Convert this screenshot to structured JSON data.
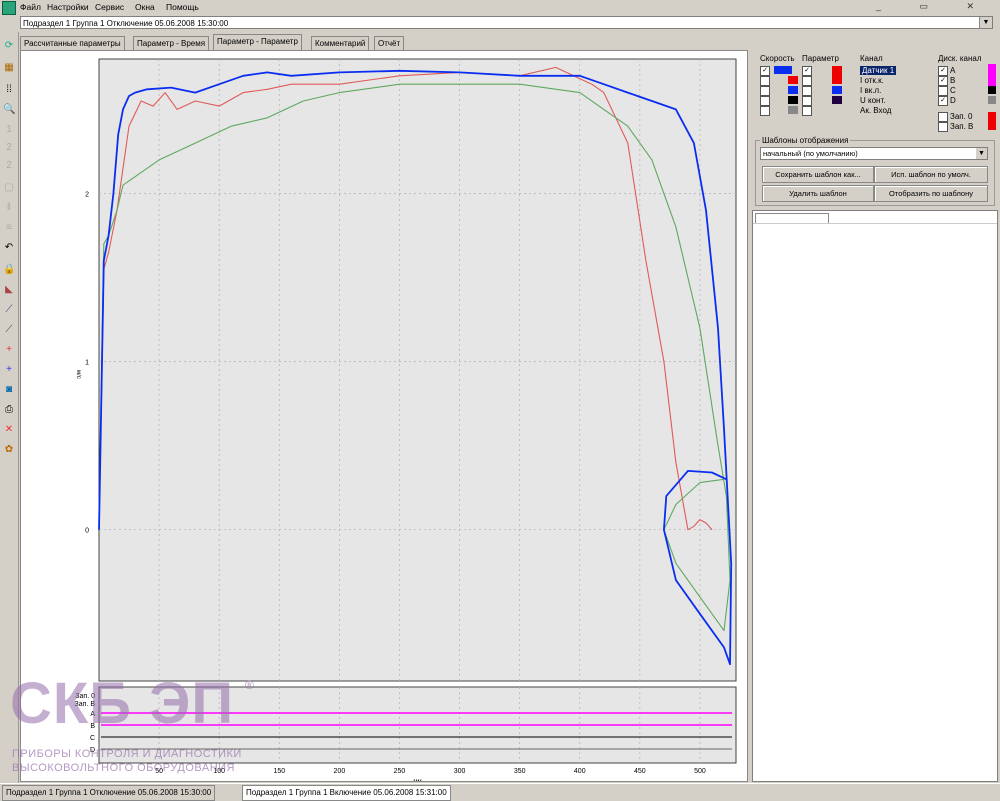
{
  "menu": {
    "items": [
      "Файл",
      "Настройки",
      "Сервис",
      "Окна",
      "Помощь"
    ]
  },
  "window": {
    "title": "Подраздел 1 Группа 1 Отключение 05.06.2008 15:30:00"
  },
  "tabs": [
    "Рассчитанные параметры",
    "Параметр - Время",
    "Параметр - Параметр",
    "Комментарий",
    "Отчёт"
  ],
  "active_tab": 2,
  "right": {
    "headers": {
      "speed": "Скорость",
      "param": "Параметр",
      "channel": "Канал",
      "discrete": "Диск. канал"
    },
    "channels": [
      "Датчик 1",
      "I отк.к.",
      "I вк.л.",
      "U конт.",
      "Ак. Вход"
    ],
    "discrete": [
      "A",
      "B",
      "C",
      "D"
    ],
    "extra": [
      "Зап. 0",
      "Зап. B"
    ],
    "templates_label": "Шаблоны отображения",
    "template_value": "начальный (по умолчанию)",
    "buttons": {
      "save": "Сохранить шаблон как...",
      "use_default": "Исп. шаблон по умолч.",
      "delete": "Удалить шаблон",
      "show_by": "Отобразить по шаблону"
    }
  },
  "colors": {
    "red": "#e05a5a",
    "green": "#5fa85f",
    "blue": "#0a2ef0",
    "magenta": "#ff00ff",
    "grid": "#b0b0b0"
  },
  "chart_data": {
    "type": "line",
    "xlabel": "мм",
    "ylabel": "м/с",
    "xlim": [
      0,
      530
    ],
    "ylim": [
      -0.9,
      2.8
    ],
    "x_ticks": [
      50,
      100,
      150,
      200,
      250,
      300,
      350,
      400,
      450,
      500
    ],
    "y_ticks": [
      0,
      1,
      2
    ],
    "x_tick_labels": [
      "50",
      "100",
      "150",
      "200",
      "250",
      "300",
      "350",
      "400",
      "450",
      "500"
    ],
    "y_tick_labels": [
      "0",
      "1",
      "2"
    ],
    "series": [
      {
        "color": "#e05a5a",
        "x": [
          0,
          4,
          8,
          15,
          25,
          35,
          45,
          55,
          65,
          80,
          100,
          120,
          140,
          160,
          200,
          250,
          300,
          350,
          380,
          410,
          420,
          440,
          455,
          470,
          480,
          490,
          495,
          500,
          505,
          510
        ],
        "y": [
          0,
          1.55,
          1.65,
          1.9,
          2.4,
          2.55,
          2.52,
          2.6,
          2.5,
          2.55,
          2.52,
          2.6,
          2.62,
          2.65,
          2.65,
          2.7,
          2.72,
          2.7,
          2.75,
          2.65,
          2.6,
          2.3,
          1.6,
          1.0,
          0.4,
          0.0,
          0.02,
          0.06,
          0.04,
          0.0
        ]
      },
      {
        "color": "#5fa85f",
        "x": [
          0,
          4,
          8,
          15,
          20,
          30,
          50,
          80,
          110,
          140,
          170,
          200,
          250,
          300,
          350,
          400,
          420,
          440,
          460,
          480,
          500,
          515,
          522,
          525,
          520,
          500,
          480,
          470,
          480,
          500,
          520
        ],
        "y": [
          0,
          1.7,
          1.75,
          1.9,
          2.05,
          2.1,
          2.2,
          2.3,
          2.4,
          2.45,
          2.55,
          2.6,
          2.65,
          2.65,
          2.65,
          2.6,
          2.5,
          2.4,
          2.2,
          1.8,
          1.2,
          0.5,
          0.2,
          -0.3,
          -0.6,
          -0.4,
          -0.2,
          0.0,
          0.15,
          0.28,
          0.3
        ]
      },
      {
        "color": "#0a2ef0",
        "x": [
          0,
          4,
          8,
          12,
          16,
          20,
          25,
          30,
          40,
          60,
          80,
          100,
          120,
          140,
          160,
          200,
          250,
          300,
          350,
          380,
          400,
          420,
          440,
          460,
          480,
          495,
          505,
          515,
          520,
          523,
          526,
          525,
          520,
          500,
          480,
          470,
          472,
          490,
          510,
          522
        ],
        "y": [
          0,
          1.6,
          1.75,
          2.0,
          2.35,
          2.5,
          2.58,
          2.6,
          2.62,
          2.63,
          2.6,
          2.65,
          2.7,
          2.72,
          2.7,
          2.72,
          2.73,
          2.72,
          2.7,
          2.7,
          2.7,
          2.65,
          2.6,
          2.55,
          2.5,
          2.3,
          1.9,
          1.2,
          0.6,
          0.2,
          -0.2,
          -0.8,
          -0.7,
          -0.5,
          -0.3,
          0.0,
          0.2,
          0.35,
          0.34,
          0.3
        ]
      }
    ]
  },
  "mini": {
    "labels": [
      "Зап. 0",
      "Зап. B",
      "A",
      "B",
      "C",
      "D"
    ]
  },
  "logo": {
    "main": "СКБ ЭП",
    "reg": "®",
    "line1": "ПРИБОРЫ КОНТРОЛЯ И ДИАГНОСТИКИ",
    "line2": "ВЫСОКОВОЛЬТНОГО ОБОРУДОВАНИЯ"
  },
  "status": {
    "tab1": "Подраздел 1 Группа 1 Отключение 05.06.2008 15:30:00",
    "tab2": "Подраздел 1 Группа 1 Включение 05.06.2008 15:31:00"
  }
}
